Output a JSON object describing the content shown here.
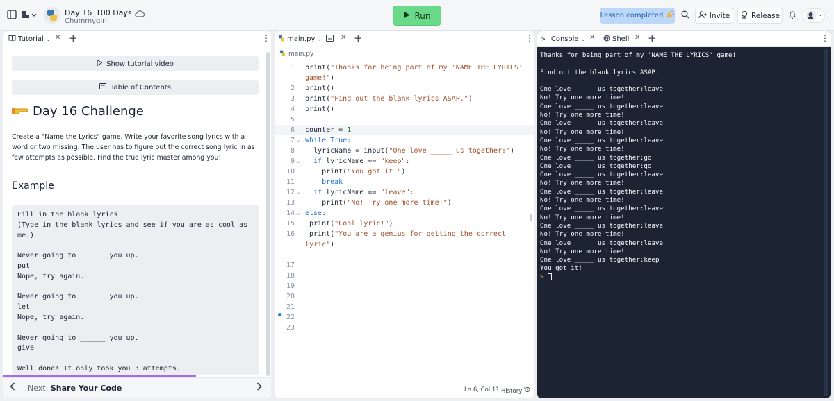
{
  "topbar": {
    "repl_name": "Day 16_100 Days",
    "owner": "Chummygirl",
    "run_label": "Run",
    "lesson_badge": "Lesson completed",
    "invite_label": "Invite",
    "release_label": "Release"
  },
  "tutorial": {
    "tab_label": "Tutorial",
    "show_video": "Show tutorial video",
    "toc": "Table of Contents",
    "title": "Day 16 Challenge",
    "description": "Create a \"Name the Lyrics\" game. Write your favorite song lyrics with a word or two missing. The user has to figure out the correct song lyric in as few attempts as possible. Find the true lyric master among you!",
    "example_heading": "Example",
    "example_text": "Fill in the blank lyrics!\n(Type in the blank lyrics and see if you are as cool as me.)\n\nNever going to ______ you up.\nput\nNope, try again.\n\nNever going to ______ you up.\nlet\nNope, try again.\n\nNever going to ______ you up.\ngive\n\nWell done! It only took you 3 attempts.",
    "next_prefix": "Next:",
    "next_title": "Share Your Code",
    "progress_fraction": 0.72
  },
  "editor": {
    "tab_label": "main.py",
    "crumb": "main.py",
    "lines": [
      {
        "n": "1",
        "fold": "",
        "html": "print(<span class='str'>\"Thanks for being part of my 'NAME THE LYRICS'</span>"
      },
      {
        "n": "",
        "fold": "",
        "html": "<span class='str'>game!\"</span>)"
      },
      {
        "n": "2",
        "fold": "",
        "html": "print()"
      },
      {
        "n": "3",
        "fold": "",
        "html": "print(<span class='str'>\"Find out the blank lyrics ASAP.\"</span>)"
      },
      {
        "n": "4",
        "fold": "",
        "html": "print()"
      },
      {
        "n": "5",
        "fold": "",
        "html": ""
      },
      {
        "n": "6",
        "fold": "",
        "html": "counter = <span class='num'>1</span>"
      },
      {
        "n": "7",
        "fold": "⌄",
        "html": "<span class='kw'>while</span> <span class='kw'>True</span>:"
      },
      {
        "n": "8",
        "fold": "",
        "html": "  lyricName = input(<span class='str'>\"One love _____ us together:\"</span>)"
      },
      {
        "n": "9",
        "fold": "⌄",
        "html": "  <span class='kw'>if</span> lyricName == <span class='str'>\"keep\"</span>:"
      },
      {
        "n": "10",
        "fold": "",
        "html": "    print(<span class='str'>\"You got it!\"</span>)"
      },
      {
        "n": "11",
        "fold": "",
        "html": "    <span class='kw'>break</span>"
      },
      {
        "n": "12",
        "fold": "⌄",
        "html": "  <span class='kw'>if</span> lyricName == <span class='str'>\"leave\"</span>:"
      },
      {
        "n": "13",
        "fold": "",
        "html": "    print(<span class='str'>\"No! Try one more time!\"</span>)"
      },
      {
        "n": "14",
        "fold": "⌄",
        "html": "<span class='kw'>else</span>:"
      },
      {
        "n": "15",
        "fold": "",
        "html": " print(<span class='str'>\"Cool lyric!\"</span>)"
      },
      {
        "n": "16",
        "fold": "",
        "html": " print(<span class='str'>\"You are a genius for getting the correct</span>"
      },
      {
        "n": "",
        "fold": "",
        "html": "<span class='str'>lyric\"</span>)"
      },
      {
        "n": "",
        "fold": "",
        "html": ""
      },
      {
        "n": "17",
        "fold": "",
        "html": ""
      },
      {
        "n": "18",
        "fold": "",
        "html": ""
      },
      {
        "n": "19",
        "fold": "",
        "html": ""
      },
      {
        "n": "20",
        "fold": "",
        "html": ""
      },
      {
        "n": "21",
        "fold": "",
        "html": ""
      },
      {
        "n": "22",
        "fold": "",
        "html": ""
      },
      {
        "n": "23",
        "fold": "",
        "html": ""
      }
    ],
    "active_line_index": 6,
    "status": "Ln 6, Col 11",
    "history_label": "History"
  },
  "console": {
    "tab_console": "Console",
    "tab_shell": "Shell",
    "lines": [
      "Thanks for being part of my 'NAME THE LYRICS' game!",
      "",
      "Find out the blank lyrics ASAP.",
      "",
      "One love _____ us together:leave",
      "No! Try one more time!",
      "One love _____ us together:leave",
      "No! Try one more time!",
      "One love _____ us together:leave",
      "No! Try one more time!",
      "One love _____ us together:leave",
      "No! Try one more time!",
      "One love _____ us together:go",
      "One love _____ us together:go",
      "One love _____ us together:leave",
      "No! Try one more time!",
      "One love _____ us together:leave",
      "No! Try one more time!",
      "One love _____ us together:leave",
      "No! Try one more time!",
      "One love _____ us together:leave",
      "No! Try one more time!",
      "One love _____ us together:leave",
      "No! Try one more time!",
      "One love _____ us together:keep",
      "You got it!"
    ],
    "prompt": ">"
  }
}
